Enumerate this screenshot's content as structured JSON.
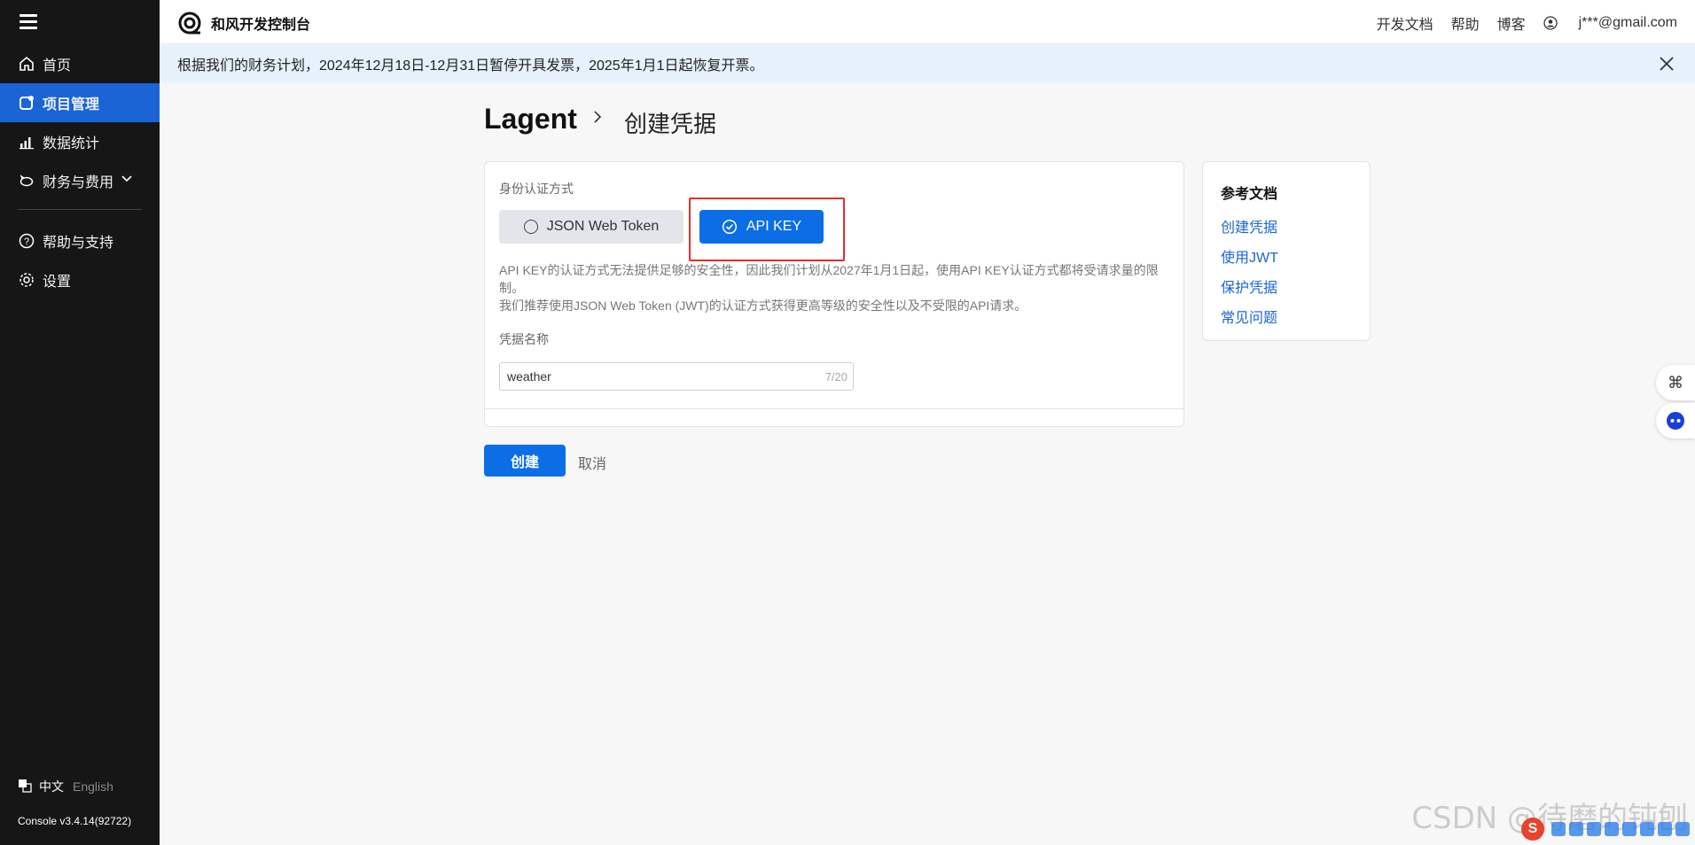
{
  "sidebar": {
    "items": [
      {
        "label": "首页",
        "icon": "home-icon"
      },
      {
        "label": "项目管理",
        "icon": "project-icon",
        "active": true
      },
      {
        "label": "数据统计",
        "icon": "bar-chart-icon"
      },
      {
        "label": "财务与费用",
        "icon": "piggy-bank-icon",
        "has_children": true
      },
      {
        "label": "帮助与支持",
        "icon": "help-icon"
      },
      {
        "label": "设置",
        "icon": "gear-icon"
      }
    ],
    "lang_zh": "中文",
    "lang_en": "English",
    "version": "Console v3.4.14(92722)"
  },
  "topbar": {
    "brand": "和风开发控制台",
    "links": [
      "开发文档",
      "帮助",
      "博客"
    ],
    "user": "j***@gmail.com"
  },
  "notice": {
    "text": "根据我们的财务计划，2024年12月18日-12月31日暂停开具发票，2025年1月1日起恢复开票。"
  },
  "breadcrumb": {
    "project": "Lagent",
    "page": "创建凭据"
  },
  "form": {
    "auth_label": "身份认证方式",
    "option_jwt": "JSON Web Token",
    "option_api": "API KEY",
    "selected": "API KEY",
    "desc_line1": "API KEY的认证方式无法提供足够的安全性，因此我们计划从2027年1月1日起，使用API KEY认证方式都将受请求量的限制。",
    "desc_line2": "我们推荐使用JSON Web Token (JWT)的认证方式获得更高等级的安全性以及不受限的API请求。",
    "name_label": "凭据名称",
    "name_value": "weather",
    "name_count": "7/20"
  },
  "reference": {
    "title": "参考文档",
    "links": [
      "创建凭据",
      "使用JWT",
      "保护凭据",
      "常见问题"
    ]
  },
  "actions": {
    "create": "创建",
    "cancel": "取消"
  },
  "watermark": "CSDN @待磨的钝刨",
  "colors": {
    "primary": "#0c6ee6",
    "sidebar_bg": "#161616",
    "sidebar_active": "#1b64d6",
    "notice_bg": "#e6f1fc",
    "highlight_border": "#e0302a"
  }
}
